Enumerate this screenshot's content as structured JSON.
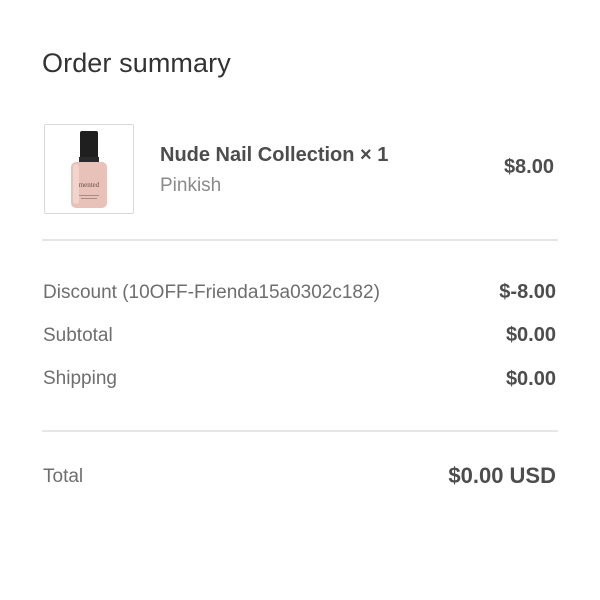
{
  "order_summary": {
    "title": "Order summary",
    "item": {
      "name": "Nude Nail Collection × 1",
      "variant": "Pinkish",
      "price": "$8.00",
      "image_brand_text": "mented",
      "image_icon": "nail-polish-bottle-icon"
    },
    "lines": {
      "discount_label": "Discount (10OFF-Frienda15a0302c182)",
      "discount_value": "$-8.00",
      "subtotal_label": "Subtotal",
      "subtotal_value": "$0.00",
      "shipping_label": "Shipping",
      "shipping_value": "$0.00"
    },
    "total": {
      "label": "Total",
      "value": "$0.00 USD"
    }
  }
}
